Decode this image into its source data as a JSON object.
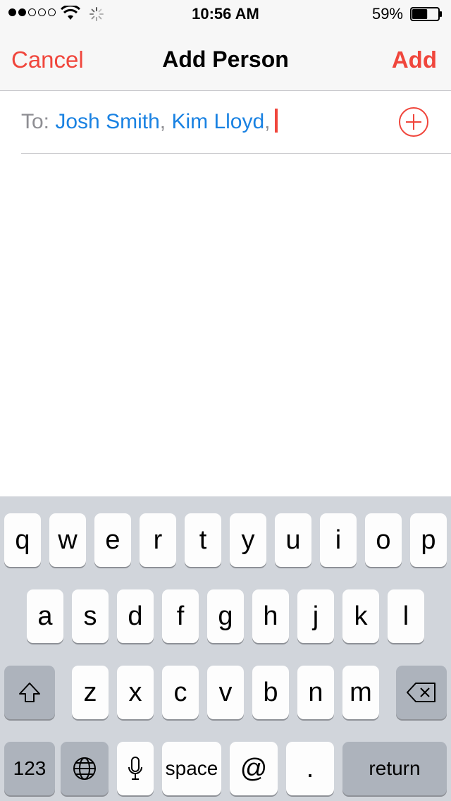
{
  "status_bar": {
    "signal": {
      "filled": 2,
      "total": 5
    },
    "time": "10:56 AM",
    "battery_percent": "59%",
    "battery_level": 0.59,
    "icons": [
      "wifi-icon",
      "activity-spinner-icon",
      "battery-icon"
    ]
  },
  "nav": {
    "cancel": "Cancel",
    "title": "Add Person",
    "add": "Add"
  },
  "to_field": {
    "label": "To:",
    "recipients": [
      "Josh Smith",
      "Kim Lloyd"
    ],
    "separator": ","
  },
  "keyboard": {
    "row1": [
      "q",
      "w",
      "e",
      "r",
      "t",
      "y",
      "u",
      "i",
      "o",
      "p"
    ],
    "row2": [
      "a",
      "s",
      "d",
      "f",
      "g",
      "h",
      "j",
      "k",
      "l"
    ],
    "row3": [
      "z",
      "x",
      "c",
      "v",
      "b",
      "n",
      "m"
    ],
    "row4": {
      "numbers": "123",
      "globe": "globe-icon",
      "mic": "microphone-icon",
      "space": "space",
      "at": "@",
      "period": ".",
      "return": "return"
    }
  },
  "colors": {
    "accent": "#f0463c",
    "link": "#1a82e2",
    "keyboard_bg": "#d1d5db"
  }
}
